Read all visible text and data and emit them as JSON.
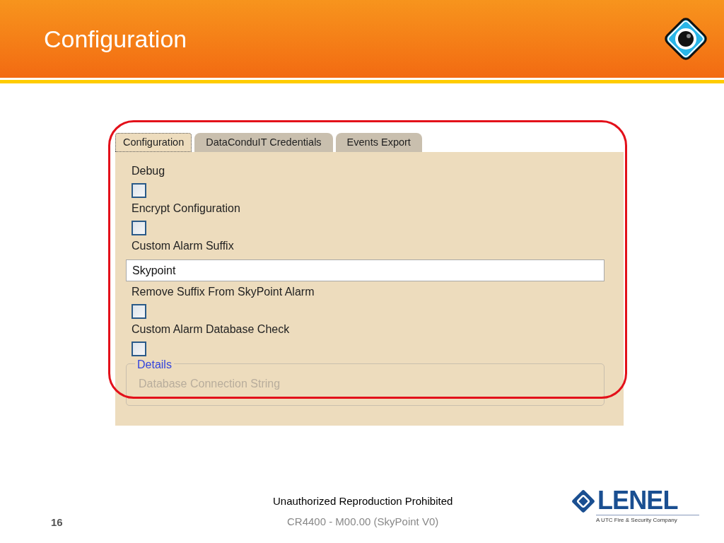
{
  "slide_title": "Configuration",
  "tabs": [
    {
      "label": "Configuration",
      "selected": true
    },
    {
      "label": "DataConduIT Credentials",
      "selected": false
    },
    {
      "label": "Events Export",
      "selected": false
    }
  ],
  "fields": [
    {
      "kind": "checkbox",
      "label": "Debug",
      "checked": false
    },
    {
      "kind": "checkbox",
      "label": "Encrypt Configuration",
      "checked": false
    },
    {
      "kind": "text",
      "label": "Custom Alarm Suffix",
      "value": "Skypoint"
    },
    {
      "kind": "checkbox",
      "label": "Remove Suffix From SkyPoint Alarm",
      "checked": false
    },
    {
      "kind": "checkbox",
      "label": "Custom Alarm Database Check",
      "checked": false
    }
  ],
  "details": {
    "title": "Details",
    "field_label": "Database Connection String"
  },
  "footer": {
    "notice": "Unauthorized Reproduction Prohibited",
    "page_number": "16",
    "document": "CR4400 - M00.00 (SkyPoint V0)",
    "logo_text": "LENEL",
    "logo_tagline": "A UTC Fire & Security Company"
  }
}
